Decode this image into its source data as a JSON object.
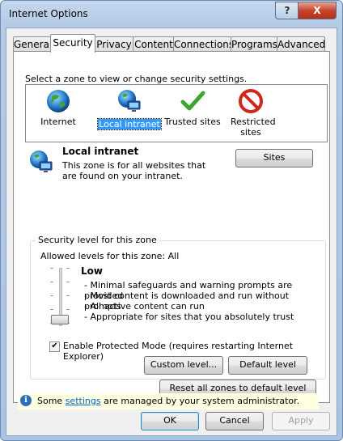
{
  "window": {
    "title": "Internet Options",
    "help_glyph": "?",
    "close_glyph": "X"
  },
  "tabs": [
    "General",
    "Security",
    "Privacy",
    "Content",
    "Connections",
    "Programs",
    "Advanced"
  ],
  "security": {
    "prompt": "Select a zone to view or change security settings.",
    "zones": [
      {
        "label": "Internet",
        "icon": "globe-icon"
      },
      {
        "label": "Local intranet",
        "icon": "intranet-icon"
      },
      {
        "label": "Trusted sites",
        "icon": "checkmark-icon"
      },
      {
        "label": "Restricted sites",
        "icon": "restricted-icon"
      }
    ],
    "selected_zone": "Local intranet",
    "zone_title": "Local intranet",
    "zone_description": "This zone is for all websites that are found on your intranet.",
    "sites_button": "Sites",
    "group_title": "Security level for this zone",
    "allowed_levels": "Allowed levels for this zone: All",
    "level_name": "Low",
    "level_bullets": [
      "- Minimal safeguards and warning prompts are provided",
      "- Most content is downloaded and run without prompts",
      "- All active content can run",
      "- Appropriate for sites that you absolutely trust"
    ],
    "protected_mode_label": "Enable Protected Mode (requires restarting Internet Explorer)",
    "protected_mode_checked": true,
    "checkmark_glyph": "✔",
    "custom_level_button": "Custom level...",
    "default_level_button": "Default level",
    "reset_button": "Reset all zones to default level",
    "info_prefix": "Some",
    "info_link": "settings",
    "info_suffix": "are managed by your system administrator.",
    "info_icon_glyph": "i"
  },
  "footer": {
    "ok": "OK",
    "cancel": "Cancel",
    "apply": "Apply"
  }
}
